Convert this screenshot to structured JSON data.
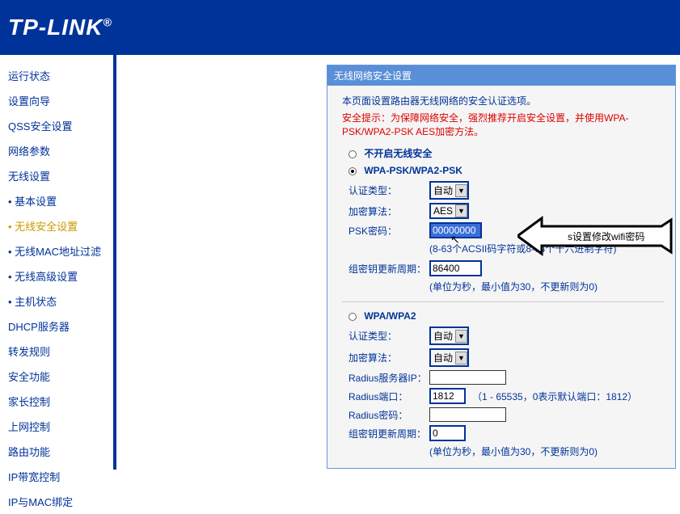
{
  "logo": "TP-LINK",
  "sidebar": {
    "items": [
      {
        "label": "运行状态"
      },
      {
        "label": "设置向导"
      },
      {
        "label": "QSS安全设置"
      },
      {
        "label": "网络参数"
      },
      {
        "label": "无线设置"
      },
      {
        "label": "基本设置",
        "sub": true
      },
      {
        "label": "无线安全设置",
        "sub": true,
        "active": true
      },
      {
        "label": "无线MAC地址过滤",
        "sub": true
      },
      {
        "label": "无线高级设置",
        "sub": true
      },
      {
        "label": "主机状态",
        "sub": true
      },
      {
        "label": "DHCP服务器"
      },
      {
        "label": "转发规则"
      },
      {
        "label": "安全功能"
      },
      {
        "label": "家长控制"
      },
      {
        "label": "上网控制"
      },
      {
        "label": "路由功能"
      },
      {
        "label": "IP带宽控制"
      },
      {
        "label": "IP与MAC绑定"
      }
    ]
  },
  "panel": {
    "title": "无线网络安全设置",
    "intro": "本页面设置路由器无线网络的安全认证选项。",
    "warn": "安全提示：为保障网络安全，强烈推荐开启安全设置，并使用WPA-PSK/WPA2-PSK AES加密方法。",
    "opt_disable": "不开启无线安全",
    "opt_wpapsk": "WPA-PSK/WPA2-PSK",
    "auth_label": "认证类型：",
    "auth_value": "自动",
    "enc_label": "加密算法：",
    "enc_value": "AES",
    "psk_label": "PSK密码：",
    "psk_value": "00000000",
    "psk_hint": "(8-63个ACSII码字符或8-64个十六进制字符)",
    "gk_label": "组密钥更新周期：",
    "gk_value": "86400",
    "gk_hint": "(单位为秒，最小值为30，不更新则为0)",
    "opt_wpa": "WPA/WPA2",
    "auth2_value": "自动",
    "enc2_value": "自动",
    "radius_ip_label": "Radius服务器IP：",
    "radius_ip_value": "",
    "radius_port_label": "Radius端口：",
    "radius_port_value": "1812",
    "radius_port_hint": "（1 - 65535，0表示默认端口：1812）",
    "radius_pw_label": "Radius密码：",
    "radius_pw_value": "",
    "gk2_value": "0"
  },
  "callout": "s设置修改wifi密码"
}
